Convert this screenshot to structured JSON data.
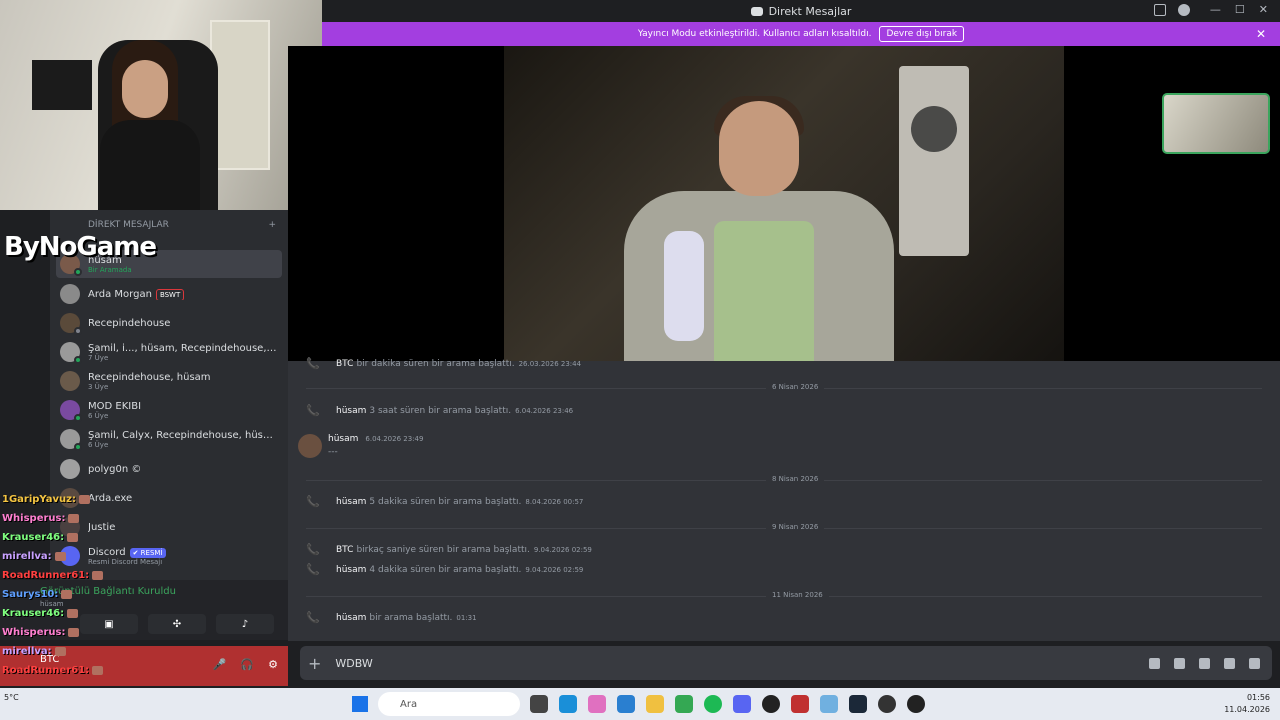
{
  "titlebar": {
    "title": "Direkt Mesajlar",
    "help_icon": "help-icon",
    "minimize": "—",
    "maximize": "☐",
    "close": "✕"
  },
  "banner": {
    "text": "Yayıncı Modu etkinleştirildi. Kullanıcı adları kısaltıldı.",
    "button": "Devre dışı bırak",
    "close": "✕"
  },
  "overlay_logo": "ByNoGame",
  "dm_header": {
    "label": "DİREKT MESAJLAR",
    "add": "+"
  },
  "dms": [
    {
      "name": "hüsam",
      "sub": "Bir Aramada",
      "active": true
    },
    {
      "name": "Arda Morgan",
      "tag": "BSWT",
      "sub": ""
    },
    {
      "name": "Recepindehouse",
      "sub": ""
    },
    {
      "name": "Şamil, i..., hüsam, Recepindehouse, Calyx...",
      "sub": "7 Üye"
    },
    {
      "name": "Recepindehouse, hüsam",
      "sub": "3 Üye"
    },
    {
      "name": "MOD EKİBİ",
      "sub": "6 Üye"
    },
    {
      "name": "Şamil, Calyx, Recepindehouse, hüsam, u...",
      "sub": "6 Üye"
    },
    {
      "name": "polyg0n ©",
      "sub": ""
    },
    {
      "name": "Arda.exe",
      "sub": ""
    },
    {
      "name": "Justie",
      "sub": ""
    },
    {
      "name": "Discord",
      "tag": "✔ RESMİ",
      "sub": "Resmi Discord Mesajı"
    }
  ],
  "voice": {
    "title": "Görüntülü Bağlantı Kuruldu",
    "sub": "hüsam"
  },
  "user": {
    "name": "BTC"
  },
  "chat_overlay": [
    "1GaripYavuz:",
    "Whisperus:",
    "Krauser46:",
    "mirellva:",
    "RoadRunner61:",
    "Saurys10:",
    "Krauser46:",
    "Whisperus:",
    "mirellva:",
    "RoadRunner61:"
  ],
  "messages": [
    {
      "user": "BTC",
      "text": "bir dakika süren bir arama başlattı.",
      "ts": "26.03.2026 23:44"
    },
    {
      "divider": "6 Nisan 2026"
    },
    {
      "user": "hüsam",
      "text": "3 saat süren bir arama başlattı.",
      "ts": "6.04.2026 23:46"
    },
    {
      "user": "hüsam",
      "text": "---",
      "ts": "6.04.2026 23:49",
      "avatar": true
    },
    {
      "divider": "8 Nisan 2026"
    },
    {
      "user": "hüsam",
      "text": "5 dakika süren bir arama başlattı.",
      "ts": "8.04.2026 00:57"
    },
    {
      "divider": "9 Nisan 2026"
    },
    {
      "user": "BTC",
      "text": "birkaç saniye süren bir arama başlattı.",
      "ts": "9.04.2026 02:59"
    },
    {
      "user": "hüsam",
      "text": "4 dakika süren bir arama başlattı.",
      "ts": "9.04.2026 02:59"
    },
    {
      "divider": "11 Nisan 2026"
    },
    {
      "user": "hüsam",
      "text": "bir arama başlattı.",
      "ts": "01:31"
    }
  ],
  "composer": {
    "value": "WDBW"
  },
  "taskbar": {
    "search": "Ara",
    "time": "01:56",
    "date": "11.04.2026",
    "temp": "5°C"
  }
}
